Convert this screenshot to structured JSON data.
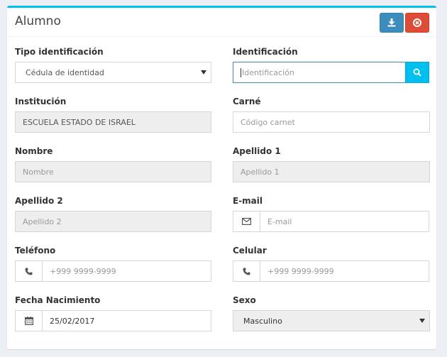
{
  "panel": {
    "title": "Alumno",
    "buttons": [
      {
        "name": "download",
        "icon": "download-icon",
        "color": "#3c8dbc"
      },
      {
        "name": "close",
        "icon": "close-circle-icon",
        "color": "#dd4b39"
      }
    ]
  },
  "form": {
    "tipo_identificacion": {
      "label": "Tipo identificación",
      "value": "Cédula de identidad"
    },
    "identificacion": {
      "label": "Identificación",
      "placeholder": "Identificación",
      "search_icon": "search-icon"
    },
    "institucion": {
      "label": "Institución",
      "value": "ESCUELA ESTADO DE ISRAEL"
    },
    "carne": {
      "label": "Carné",
      "placeholder": "Código carnet"
    },
    "nombre": {
      "label": "Nombre",
      "placeholder": "Nombre"
    },
    "apellido1": {
      "label": "Apellido 1",
      "placeholder": "Apellido 1"
    },
    "apellido2": {
      "label": "Apellido 2",
      "placeholder": "Apellido 2"
    },
    "email": {
      "label": "E-mail",
      "placeholder": "E-mail",
      "icon": "envelope-icon"
    },
    "telefono": {
      "label": "Teléfono",
      "placeholder": "+999 9999-9999",
      "icon": "phone-icon"
    },
    "celular": {
      "label": "Celular",
      "placeholder": "+999 9999-9999",
      "icon": "phone-icon"
    },
    "fecha_nacimiento": {
      "label": "Fecha Nacimiento",
      "value": "25/02/2017",
      "icon": "calendar-icon"
    },
    "sexo": {
      "label": "Sexo",
      "value": "Masculino"
    }
  },
  "colors": {
    "accent": "#00c0ef",
    "primary": "#3c8dbc",
    "danger": "#dd4b39",
    "readonly_bg": "#eeeeee"
  }
}
